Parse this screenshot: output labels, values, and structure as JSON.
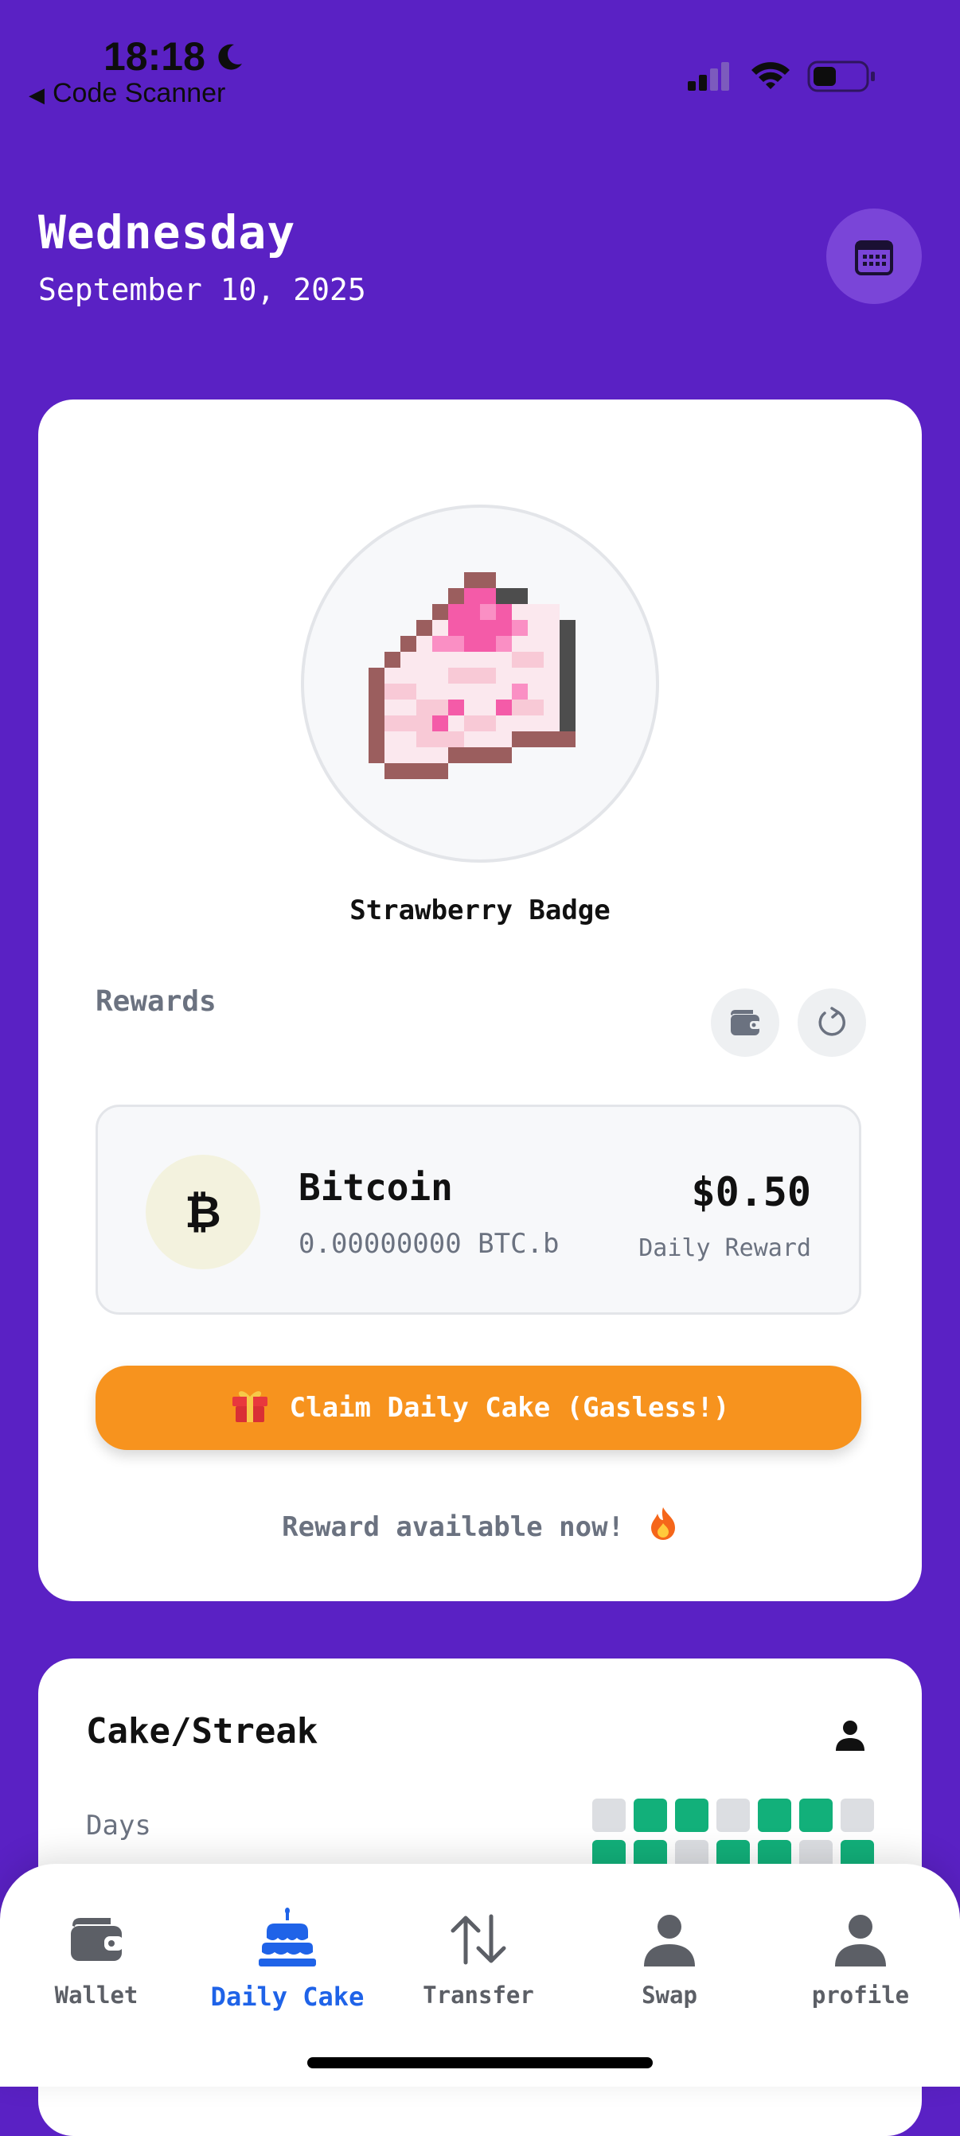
{
  "status_bar": {
    "time": "18:18",
    "back_label": "Code Scanner",
    "moon_icon": "moon-icon",
    "signal_icon": "cellular-signal-icon",
    "wifi_icon": "wifi-icon",
    "battery_icon": "battery-icon"
  },
  "header": {
    "day": "Wednesday",
    "date": "September 10, 2025",
    "calendar_icon": "calendar-icon"
  },
  "badge": {
    "name": "Strawberry Badge",
    "image_icon": "strawberry-cake-pixel-icon"
  },
  "rewards": {
    "label": "Rewards",
    "wallet_icon": "wallet-icon",
    "refresh_icon": "refresh-icon",
    "coin": {
      "symbol": "₿",
      "name": "Bitcoin",
      "amount": "0.00000000 BTC.b",
      "value": "$0.50",
      "value_label": "Daily Reward"
    },
    "claim_button": "Claim Daily Cake (Gasless!)",
    "claim_icon": "gift-icon",
    "status": "Reward available now!",
    "status_icon": "fire-icon"
  },
  "streak": {
    "title": "Cake/Streak",
    "days_label": "Days",
    "person_icon": "person-icon",
    "cells": [
      false,
      true,
      true,
      false,
      true,
      true,
      false,
      true,
      true,
      false,
      true,
      true,
      false,
      true
    ]
  },
  "bottom_nav": {
    "items": [
      {
        "label": "Wallet",
        "icon": "wallet-icon",
        "active": false
      },
      {
        "label": "Daily Cake",
        "icon": "birthday-cake-icon",
        "active": true
      },
      {
        "label": "Transfer",
        "icon": "transfer-arrows-icon",
        "active": false
      },
      {
        "label": "Swap",
        "icon": "person-icon",
        "active": false
      },
      {
        "label": "profile",
        "icon": "person-icon",
        "active": false
      }
    ]
  },
  "colors": {
    "background": "#5a21c4",
    "claim_button": "#f7931e",
    "streak_active": "#12b07a",
    "nav_active": "#1f63e8"
  }
}
